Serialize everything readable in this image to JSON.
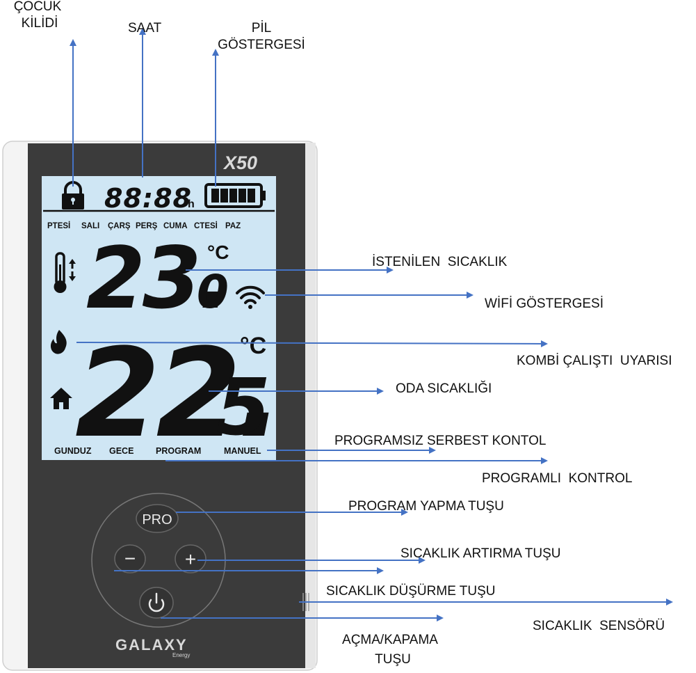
{
  "device": {
    "model": "X50",
    "clock": "88:88",
    "clock_unit": "h",
    "days": [
      "PTESİ",
      "SALI",
      "ÇARŞ",
      "PERŞ",
      "CUMA",
      "CTESİ",
      "PAZ"
    ],
    "set_temp_int": "23.",
    "set_temp_dec": "0",
    "set_unit": "°C",
    "room_temp_int": "22.",
    "room_temp_dec": "5",
    "room_unit": "°C",
    "modes": [
      "GUNDUZ",
      "GECE",
      "PROGRAM",
      "MANUEL"
    ],
    "pro_label": "PRO",
    "minus_label": "−",
    "plus_label": "+",
    "brand": "GALAXY",
    "brand_sub": "Energy",
    "battery_bars": 5,
    "colors": {
      "lcd": "#cfe6f4",
      "body": "#3a3a3a",
      "frame": "#f2f2f2",
      "arrow": "#4472c4",
      "segment": "#111111"
    }
  },
  "callouts": {
    "cocuk_kilidi": [
      "ÇOCUK",
      "KİLİDİ"
    ],
    "saat": "SAAT",
    "pil": [
      "PİL",
      "GÖSTERGESİ"
    ],
    "istenilen": "İSTENİLEN  SICAKLIK",
    "wifi": "WİFİ GÖSTERGESİ",
    "kombi": "KOMBİ ÇALIŞTI  UYARISI",
    "oda": "ODA SICAKLIĞI",
    "programsiz": "PROGRAMSIZ SERBEST KONTOL",
    "programli": "PROGRAMLI  KONTROL",
    "program_yapma": "PROGRAM YAPMA TUŞU",
    "artirma": "SICAKLIK ARTIRMA TUŞU",
    "dusurme": "SICAKLIK DÜŞÜRME TUŞU",
    "sensor": "SICAKLIK  SENSÖRÜ",
    "acma": [
      "AÇMA/KAPAMA",
      "TUŞU"
    ]
  }
}
